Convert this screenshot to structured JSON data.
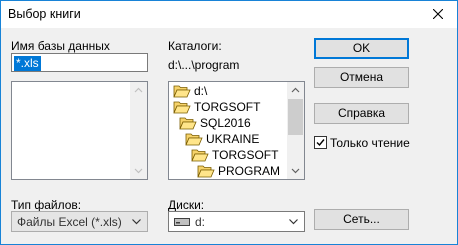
{
  "window": {
    "title": "Выбор книги"
  },
  "filename": {
    "label": "Имя базы данных",
    "value": "*.xls"
  },
  "dirs": {
    "label": "Каталоги:",
    "current_path": "d:\\...\\program",
    "items": [
      "d:\\",
      "TORGSOFT",
      "SQL2016",
      "UKRAINE",
      "TORGSOFT",
      "PROGRAM"
    ]
  },
  "filetype": {
    "label": "Тип файлов:",
    "value": "Файлы Excel (*.xls)"
  },
  "drives": {
    "label": "Диски:",
    "value": "d:"
  },
  "buttons": {
    "ok": "OK",
    "cancel": "Отмена",
    "help": "Справка",
    "network": "Сеть..."
  },
  "readonly": {
    "label": "Только чтение",
    "checked": true
  }
}
